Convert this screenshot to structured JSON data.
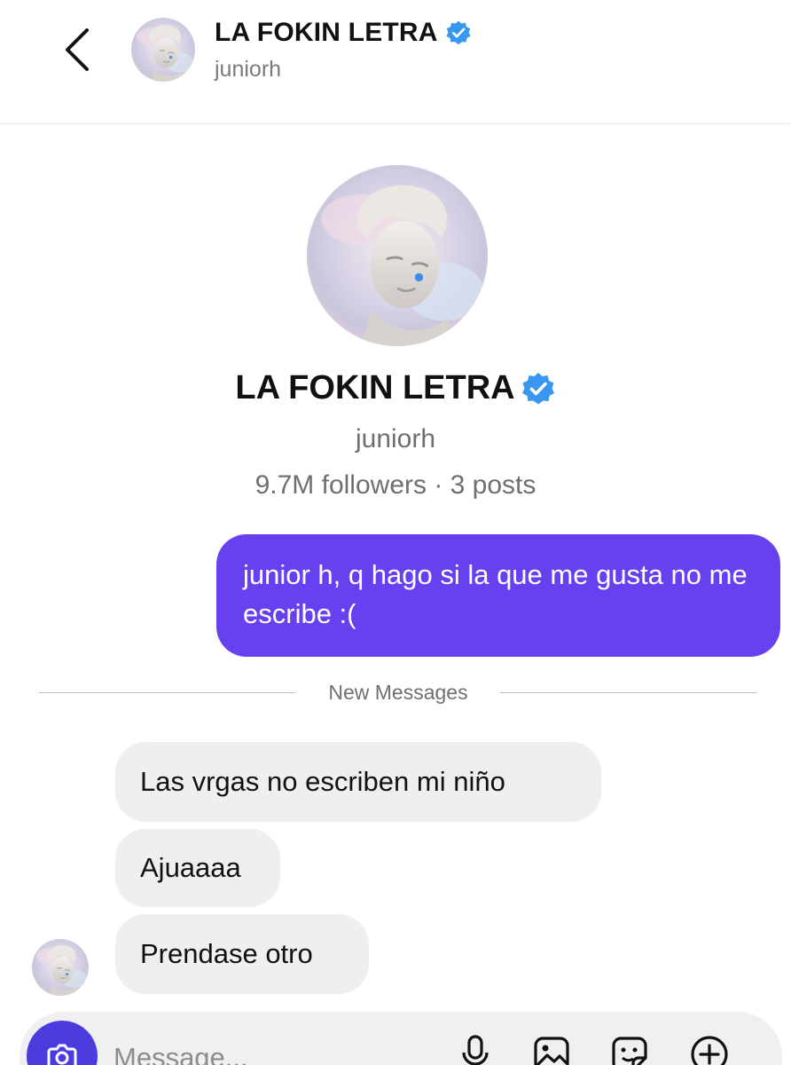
{
  "header": {
    "name": "LA FOKIN LETRA",
    "handle": "juniorh"
  },
  "profile": {
    "name": "LA FOKIN LETRA",
    "handle": "juniorh",
    "stats": "9.7M followers · 3 posts"
  },
  "messages": {
    "sent": [
      "junior h, q hago si la que me gusta no me escribe :("
    ],
    "divider_label": "New Messages",
    "received": [
      "Las vrgas no escriben mi niño",
      "Ajuaaaa",
      "Prendase otro"
    ]
  },
  "composer": {
    "placeholder": "Message..."
  },
  "colors": {
    "sent_bubble": "#6741ef",
    "received_bubble": "#efeff1",
    "verified_badge": "#3897f0",
    "camera_button": "#4c3ce0"
  },
  "icons": {
    "back": "chevron-left-icon",
    "verified": "verified-badge-icon",
    "camera": "camera-icon",
    "mic": "microphone-icon",
    "gallery": "gallery-icon",
    "sticker": "sticker-icon",
    "add": "plus-circle-icon"
  }
}
